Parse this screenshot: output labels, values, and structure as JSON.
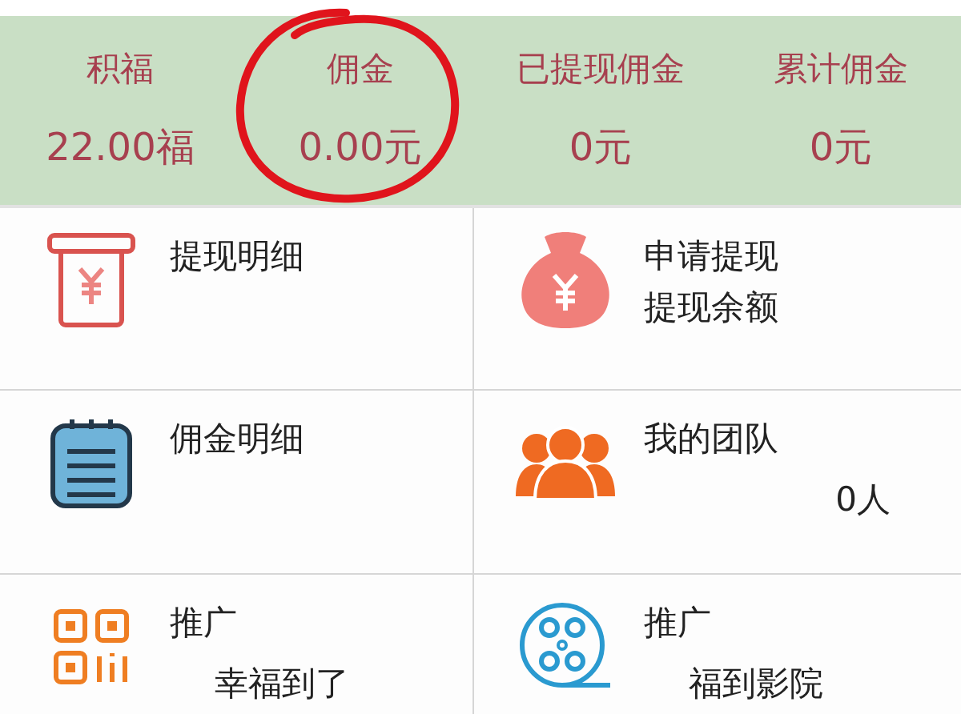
{
  "stats": [
    {
      "label": "积福",
      "value": "22.00福"
    },
    {
      "label": "佣金",
      "value": "0.00元"
    },
    {
      "label": "已提现佣金",
      "value": "0元"
    },
    {
      "label": "累计佣金",
      "value": "0元"
    }
  ],
  "menu": [
    {
      "kind": "withdraw-record",
      "title": "提现明细"
    },
    {
      "kind": "money-bag",
      "title": "申请提现",
      "subtitle": "提现余额"
    },
    {
      "kind": "notepad",
      "title": "佣金明细"
    },
    {
      "kind": "team",
      "title": "我的团队",
      "detail": "0人"
    },
    {
      "kind": "qr",
      "title": "推广",
      "detail": "幸福到了"
    },
    {
      "kind": "film",
      "title": "推广",
      "detail": "福到影院"
    }
  ]
}
